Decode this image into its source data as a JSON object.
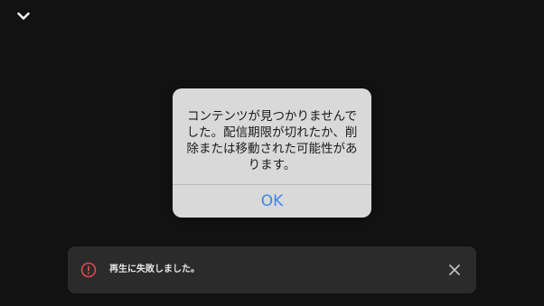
{
  "header": {
    "collapse_icon": "chevron-down-icon"
  },
  "dialog": {
    "message": "コンテンツが見つかりませんでした。配信期限が切れたか、削除または移動された可能性があります。",
    "ok_label": "OK",
    "ok_color": "#3d87e6"
  },
  "toast": {
    "icon": "error-circle-icon",
    "icon_color": "#e5484d",
    "message": "再生に失敗しました。",
    "close_icon": "close-icon"
  }
}
